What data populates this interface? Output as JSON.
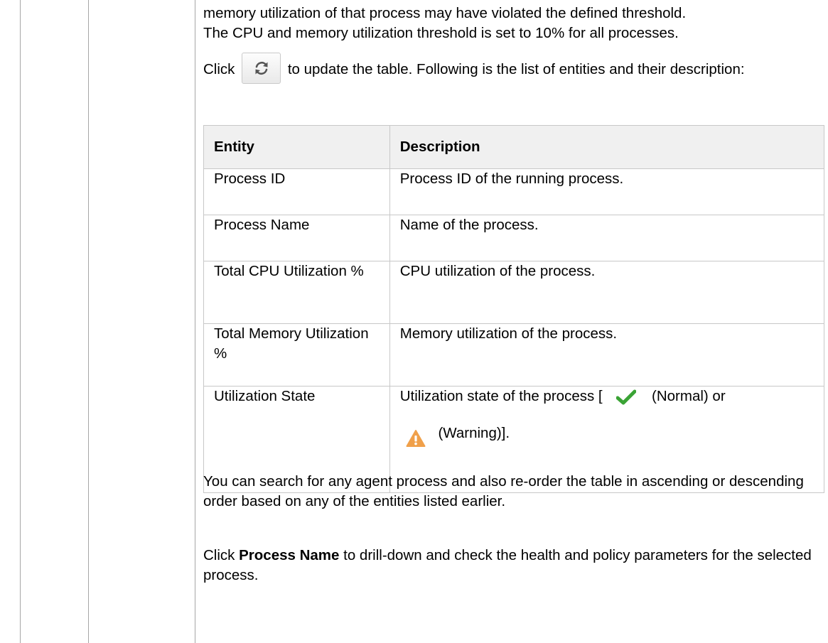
{
  "intro": {
    "line1": "memory utilization of that process may have violated the defined threshold.",
    "line2": "The CPU and memory utilization threshold is set to 10% for all processes."
  },
  "refresh": {
    "before": "Click",
    "after": "to update the table. Following is the list of entities and their description:",
    "icon": "refresh-icon"
  },
  "table": {
    "headers": [
      "Entity",
      "Description"
    ],
    "rows": [
      {
        "entity": "Process ID",
        "description": "Process ID of the running process."
      },
      {
        "entity": "Process Name",
        "description": "Name of the process."
      },
      {
        "entity": "Total CPU Utilization %",
        "description": "CPU utilization of the process."
      },
      {
        "entity": "Total Memory Utilization %",
        "description": "Memory utilization of the process."
      },
      {
        "entity": "Utilization State",
        "description_prefix": "Utilization state of the process [",
        "normal_label": "(Normal) or",
        "warning_label": "(Warning)]."
      }
    ]
  },
  "search_text": "You can search for any agent process and also re-order the table in ascending or descending order based on any of the entities listed earlier.",
  "drilldown": {
    "prefix": "Click",
    "bold": "Process Name",
    "suffix": "to drill-down and check the health and policy parameters for the selected process."
  },
  "colors": {
    "normal_check": "#3aa335",
    "warning_triangle": "#f0a04a",
    "header_bg": "#f0f0f0",
    "border": "#c8c8c8"
  }
}
